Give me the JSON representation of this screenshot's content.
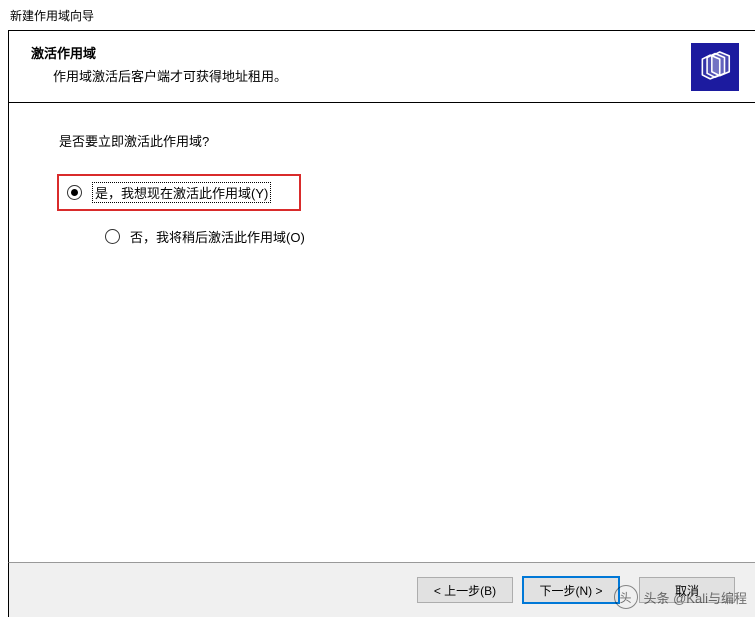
{
  "window": {
    "title": "新建作用域向导"
  },
  "header": {
    "title": "激活作用域",
    "subtitle": "作用域激活后客户端才可获得地址租用。"
  },
  "body": {
    "question": "是否要立即激活此作用域?",
    "options": {
      "yes": {
        "label": "是，我想现在激活此作用域(Y)",
        "selected": true,
        "highlighted": true
      },
      "no": {
        "label": "否，我将稍后激活此作用域(O)",
        "selected": false,
        "highlighted": false
      }
    }
  },
  "footer": {
    "back": "< 上一步(B)",
    "next": "下一步(N) >",
    "cancel": "取消"
  },
  "watermark": {
    "text": "头条 @Kali与编程"
  }
}
